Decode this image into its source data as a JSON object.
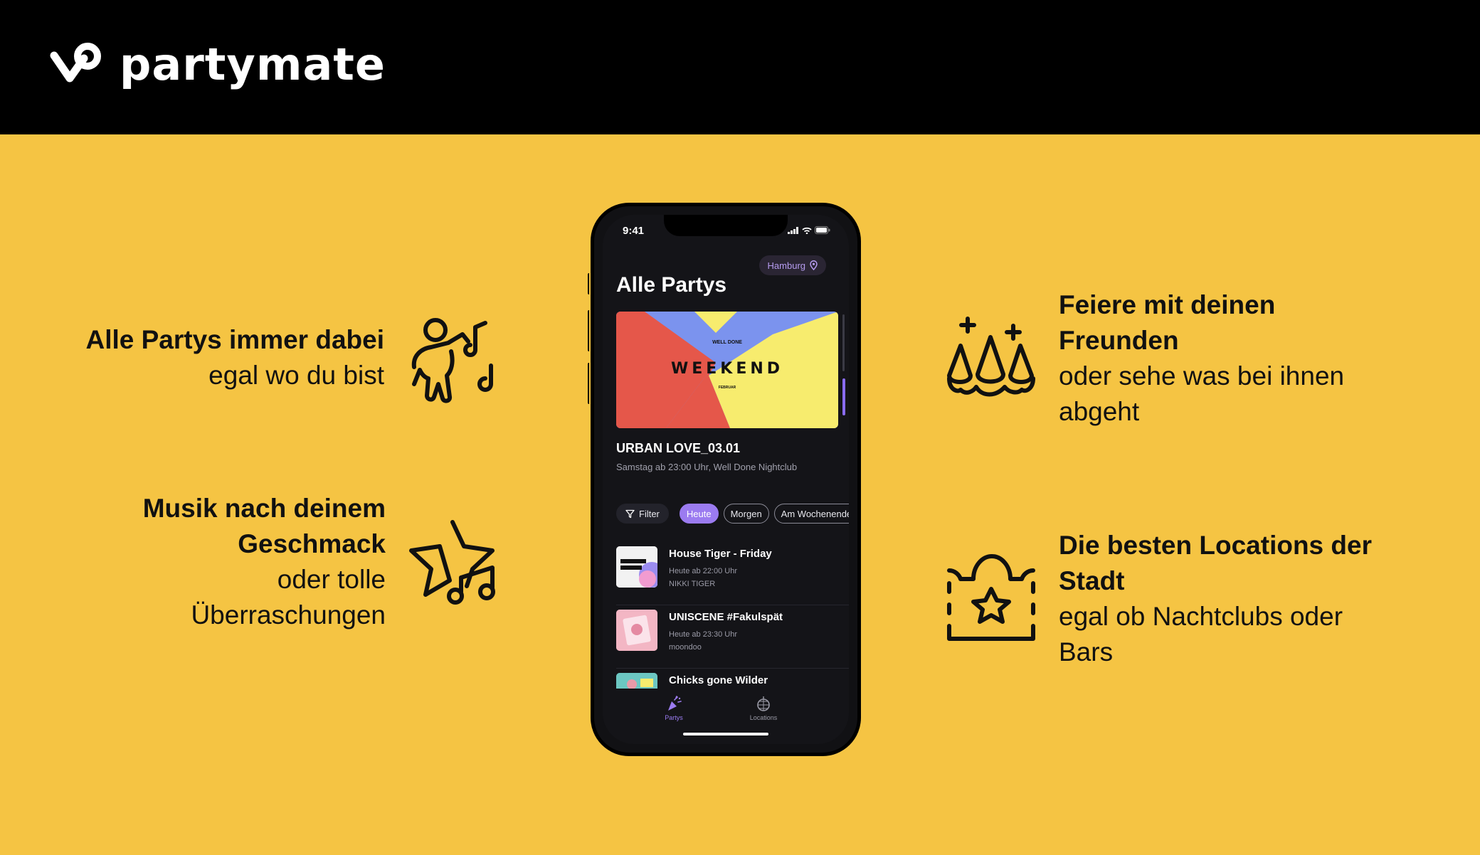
{
  "brand": {
    "name": "partymate",
    "icon": "partymate-logo-icon"
  },
  "colors": {
    "background": "#F5C443",
    "header": "#000000",
    "accent": "#9B7BF0"
  },
  "features_left": [
    {
      "title": "Alle Partys immer dabei",
      "desc_lines": [
        "egal wo du bist"
      ],
      "icon": "dancing-person-music-icon"
    },
    {
      "title_lines": [
        "Musik nach deinem",
        "Geschmack"
      ],
      "desc_lines": [
        "oder tolle",
        "Überraschungen"
      ],
      "icon": "star-music-note-icon"
    }
  ],
  "features_right": [
    {
      "title_lines": [
        "Feiere mit deinen",
        "Freunden"
      ],
      "desc_lines": [
        "oder sehe was bei ihnen",
        "abgeht"
      ],
      "icon": "party-hats-icon"
    },
    {
      "title_lines": [
        "Die besten Locations der",
        "Stadt"
      ],
      "desc_lines": [
        "egal ob Nachtclubs oder",
        "Bars"
      ],
      "icon": "venue-star-icon"
    }
  ],
  "phone": {
    "time": "9:41",
    "city": "Hamburg",
    "page_title": "Alle Partys",
    "banner": {
      "headline": "WEEKEND",
      "small_top": "WELL DONE",
      "small_bottom": "FEBRUAR"
    },
    "featured": {
      "title": "URBAN LOVE_03.01",
      "subtitle": "Samstag ab 23:00 Uhr, Well Done Nightclub"
    },
    "filter_label": "Filter",
    "chips": [
      "Heute",
      "Morgen",
      "Am Wochenende"
    ],
    "active_chip": "Heute",
    "events": [
      {
        "title": "House Tiger - Friday",
        "time": "Heute ab 22:00 Uhr",
        "host": "NIKKI TIGER"
      },
      {
        "title": "UNISCENE #Fakulspät",
        "time": "Heute ab 23:30 Uhr",
        "host": "moondoo"
      },
      {
        "title": "Chicks gone Wilder",
        "time": "",
        "host": ""
      }
    ],
    "tabs": [
      {
        "label": "Partys",
        "icon": "party-popper-icon",
        "active": true
      },
      {
        "label": "Locations",
        "icon": "disco-ball-icon",
        "active": false
      }
    ]
  }
}
